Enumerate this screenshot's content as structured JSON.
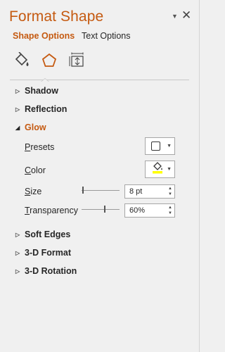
{
  "pane": {
    "title": "Format Shape"
  },
  "tabs": {
    "active": "Shape Options",
    "inactive": "Text Options"
  },
  "icons": {
    "fill_line": "paint-bucket-icon",
    "effects": "pentagon-icon",
    "size_properties": "size-properties-icon"
  },
  "sections": {
    "shadow": "Shadow",
    "reflection": "Reflection",
    "glow": "Glow",
    "soft_edges": "Soft Edges",
    "format_3d": "3-D Format",
    "rotation_3d": "3-D Rotation"
  },
  "glow": {
    "presets_label_prefix": "P",
    "presets_label_rest": "resets",
    "color_label_prefix": "C",
    "color_label_rest": "olor",
    "size_label_prefix": "S",
    "size_label_rest": "ize",
    "size_value": "8 pt",
    "size_slider_fraction": 0.05,
    "transparency_label_prefix": "T",
    "transparency_label_rest": "ransparency",
    "transparency_value": "60%",
    "transparency_slider_fraction": 0.6,
    "color_swatch": "#ffff00",
    "accent_color": "#c55a11"
  }
}
